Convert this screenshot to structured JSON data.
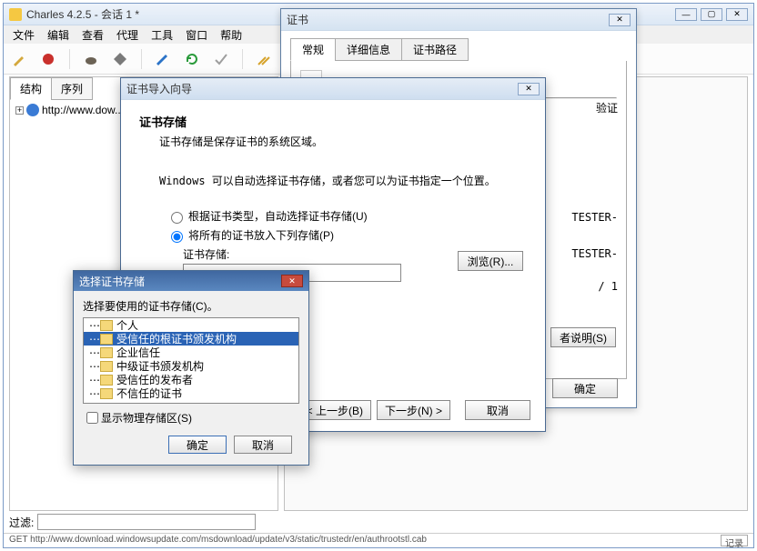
{
  "main": {
    "title": "Charles 4.2.5 - 会话 1 *",
    "menu": [
      "文件",
      "编辑",
      "查看",
      "代理",
      "工具",
      "窗口",
      "帮助"
    ],
    "tabs": {
      "structure": "结构",
      "sequence": "序列"
    },
    "tree_item": "http://www.dow...",
    "filter_label": "过滤:",
    "status": "GET http://www.download.windowsupdate.com/msdownload/update/v3/static/trustedr/en/authrootstl.cab",
    "record": "记录"
  },
  "cert_window": {
    "title": "证书",
    "tabs": [
      "常规",
      "详细信息",
      "证书路径"
    ],
    "side_verify": "验证",
    "side_lines": [
      "TESTER-",
      "TESTER-",
      "/ 1"
    ],
    "issuer_btn": "者说明(S)",
    "ok": "确定"
  },
  "wizard": {
    "title": "证书导入向导",
    "heading": "证书存储",
    "sub": "证书存储是保存证书的系统区域。",
    "hint": "Windows 可以自动选择证书存储，或者您可以为证书指定一个位置。",
    "opt_auto": "根据证书类型，自动选择证书存储(U)",
    "opt_manual": "将所有的证书放入下列存储(P)",
    "store_label": "证书存储:",
    "browse": "浏览(R)...",
    "back": "< 上一步(B)",
    "next": "下一步(N) >",
    "cancel": "取消"
  },
  "store_dialog": {
    "title": "选择证书存储",
    "prompt": "选择要使用的证书存储(C)。",
    "items": [
      "个人",
      "受信任的根证书颁发机构",
      "企业信任",
      "中级证书颁发机构",
      "受信任的发布者",
      "不信任的证书"
    ],
    "show_physical": "显示物理存储区(S)",
    "ok": "确定",
    "cancel": "取消"
  }
}
